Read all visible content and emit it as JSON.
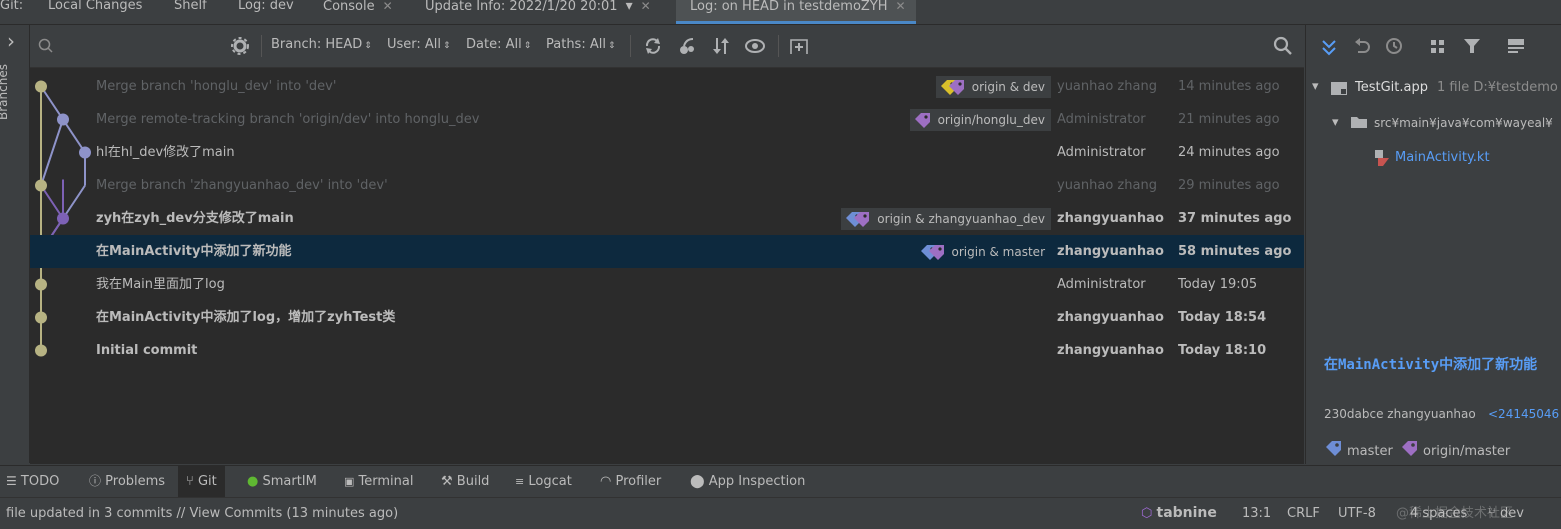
{
  "tabs": {
    "git_label": "Git:",
    "items": [
      {
        "label": "Local Changes",
        "closable": false
      },
      {
        "label": "Shelf",
        "closable": false
      },
      {
        "label": "Log: dev",
        "closable": false
      },
      {
        "label": "Console",
        "closable": true
      },
      {
        "label": "Update Info: 2022/1/20 20:01",
        "closable": true
      },
      {
        "label": "Log: on HEAD in testdemoZYH",
        "closable": true,
        "active": true
      }
    ],
    "close_glyph": "✕",
    "dropdown_glyph": "▾"
  },
  "left_panel": {
    "expand_glyph": "›",
    "branches_label": "Branches"
  },
  "toolbar": {
    "search_placeholder": "",
    "filters": {
      "branch": "Branch: HEAD",
      "user": "User: All",
      "date": "Date: All",
      "paths": "Paths: All"
    },
    "caret": "⇕"
  },
  "colors": {
    "graph_main": "#b7b383",
    "graph_branch": "#8e93c9",
    "graph_purple": "#7d61b5",
    "tag_yellow": "#d9c02b",
    "tag_purple": "#9d6fc3",
    "tag_blue": "#6e8ed6",
    "link": "#589df6",
    "selected_row": "#0d293e"
  },
  "commits": [
    {
      "message": "Merge branch 'honglu_dev' into 'dev'",
      "author": "yuanhao zhang",
      "date": "14 minutes ago",
      "refs": "origin & dev",
      "style": "dim"
    },
    {
      "message": "Merge remote-tracking branch 'origin/dev' into honglu_dev",
      "author": "Administrator",
      "date": "21 minutes ago",
      "refs": "origin/honglu_dev",
      "style": "dim"
    },
    {
      "message": "hl在hl_dev修改了main",
      "author": "Administrator",
      "date": "24 minutes ago",
      "refs": "",
      "style": "normal"
    },
    {
      "message": "Merge branch 'zhangyuanhao_dev' into 'dev'",
      "author": "yuanhao zhang",
      "date": "29 minutes ago",
      "refs": "",
      "style": "dim"
    },
    {
      "message": "zyh在zyh_dev分支修改了main",
      "author": "zhangyuanhao",
      "date": "37 minutes ago",
      "refs": "origin & zhangyuanhao_dev",
      "style": "bold"
    },
    {
      "message": "在MainActivity中添加了新功能",
      "author": "zhangyuanhao",
      "date": "58 minutes ago",
      "refs": "origin & master",
      "style": "bold-selected"
    },
    {
      "message": "我在Main里面加了log",
      "author": "Administrator",
      "date": "Today 19:05",
      "refs": "",
      "style": "normal"
    },
    {
      "message": "在MainActivity中添加了log，增加了zyhTest类",
      "author": "zhangyuanhao",
      "date": "Today 18:54",
      "refs": "",
      "style": "bold"
    },
    {
      "message": "Initial commit",
      "author": "zhangyuanhao",
      "date": "Today 18:10",
      "refs": "",
      "style": "bold"
    }
  ],
  "right_panel": {
    "tree": {
      "root": "TestGit.app",
      "root_info": "1 file  D:¥testdemo",
      "folder": "src¥main¥java¥com¥wayeal¥",
      "file": "MainActivity.kt"
    },
    "details": {
      "title": "在MainActivity中添加了新功能",
      "hash_author": "230dabce zhangyuanhao",
      "email": "<24145046",
      "branch_1": "master",
      "branch_2": "origin/master"
    }
  },
  "bottom_tools": [
    {
      "label": "TODO",
      "icon": "list-icon"
    },
    {
      "label": "Problems",
      "icon": "problems-icon"
    },
    {
      "label": "Git",
      "icon": "git-icon",
      "active": true
    },
    {
      "label": "SmartIM",
      "icon": "chat-icon"
    },
    {
      "label": "Terminal",
      "icon": "terminal-icon"
    },
    {
      "label": "Build",
      "icon": "hammer-icon"
    },
    {
      "label": "Logcat",
      "icon": "logcat-icon"
    },
    {
      "label": "Profiler",
      "icon": "gauge-icon"
    },
    {
      "label": "App Inspection",
      "icon": "inspect-icon"
    }
  ],
  "status": {
    "message": "file updated in 3 commits // View Commits (13 minutes ago)",
    "tabnine": "tabnine",
    "position": "13:1",
    "line_sep": "CRLF",
    "encoding": "UTF-8",
    "spaces": "4 spaces",
    "branch": "dev",
    "watermark": "@稀土掘金技术社区"
  }
}
